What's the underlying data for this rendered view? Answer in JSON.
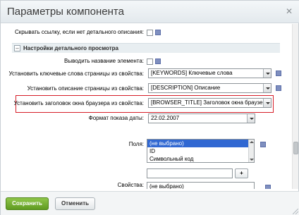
{
  "dialog": {
    "title": "Параметры компонента",
    "close_glyph": "✕"
  },
  "rows": {
    "hide_link": {
      "label": "Скрывать ссылку, если нет детального описания:",
      "checked": false
    },
    "show_name": {
      "label": "Выводить название элемента:",
      "checked": false
    },
    "keywords": {
      "label": "Установить ключевые слова страницы из свойства:",
      "value": "[KEYWORDS] Ключевые слова"
    },
    "description": {
      "label": "Установить описание страницы из свойства:",
      "value": "[DESCRIPTION] Описание"
    },
    "page_title": {
      "label": "Установить заголовок окна браузера из свойства:",
      "value": "[BROWSER_TITLE] Заголовок окна браузера"
    },
    "date_format": {
      "label": "Формат показа даты:",
      "value": "22.02.2007"
    },
    "fields": {
      "label": "Поля:",
      "options": [
        "(не выбрано)",
        "ID",
        "Символьный код"
      ],
      "selected_index": 0,
      "add_value": "",
      "add_button": "+"
    },
    "properties": {
      "label": "Свойства:",
      "value": "(не выбрано)"
    }
  },
  "section": {
    "toggle_glyph": "–",
    "title": "Настройки детального просмотра"
  },
  "footer": {
    "save_label": "Сохранить",
    "cancel_label": "Отменить"
  },
  "colors": {
    "accent_green": "#6aa62b",
    "highlight_red": "#d61e28",
    "help_icon": "#7f8fbf",
    "selected_option": "#3168d2"
  }
}
